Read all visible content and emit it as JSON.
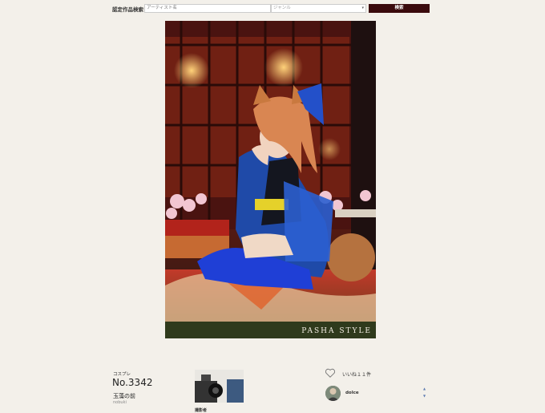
{
  "search": {
    "label": "認定作品検索",
    "artist_placeholder": "アーティスト名",
    "genre_selected": "ジャンル",
    "button_label": "検索"
  },
  "photo": {
    "watermark": "PASHA STYLE"
  },
  "work": {
    "category": "コスプレ",
    "number": "No.3342",
    "title": "玉藻の前",
    "author": "nobuki"
  },
  "credit": {
    "label": "撮影者"
  },
  "likes": {
    "text": "いいね１１件"
  },
  "comment": {
    "user": "dolce"
  },
  "icons": [
    "heart-outline-icon",
    "chevron-down-icon",
    "scroll-up-icon",
    "scroll-down-icon"
  ],
  "colors": {
    "background": "#f3f0ea",
    "search_button": "#3a0a0d"
  }
}
